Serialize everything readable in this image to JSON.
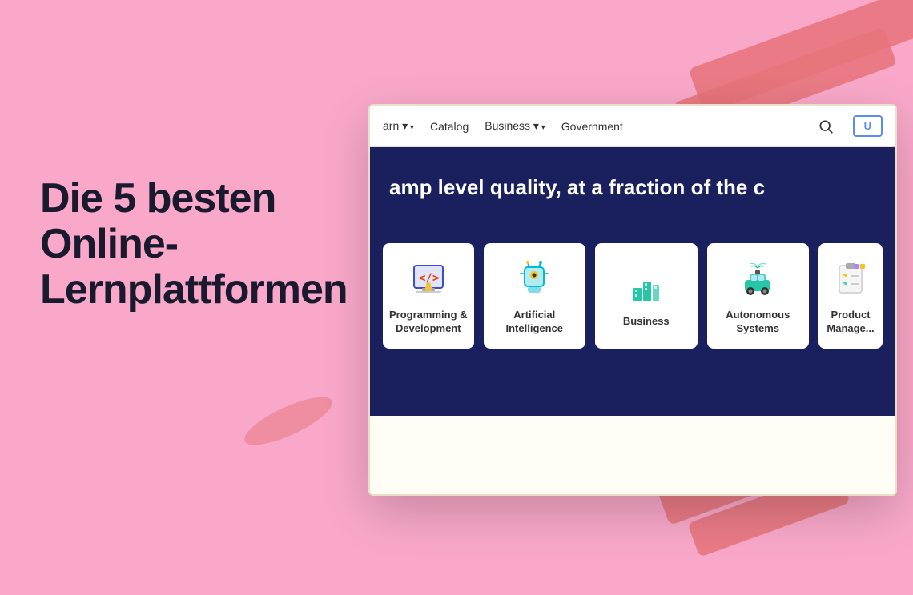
{
  "page": {
    "background_color": "#f9a8c9",
    "heading": "Die 5 besten Online-Lernplattformen"
  },
  "navbar": {
    "items": [
      {
        "label": "arn ▾",
        "has_dropdown": true,
        "id": "learn"
      },
      {
        "label": "Catalog",
        "has_dropdown": false,
        "id": "catalog"
      },
      {
        "label": "Business ▾",
        "has_dropdown": true,
        "id": "business"
      },
      {
        "label": "Government",
        "has_dropdown": false,
        "id": "government"
      }
    ],
    "search_label": "search",
    "button_label": "U"
  },
  "hero": {
    "text": "amp level quality, at a fraction of the c"
  },
  "categories": [
    {
      "id": "programming",
      "label": "Programming & Development",
      "icon_type": "programming",
      "partial": true
    },
    {
      "id": "ai",
      "label": "Artificial Intelligence",
      "icon_type": "ai",
      "partial": false
    },
    {
      "id": "business",
      "label": "Business",
      "icon_type": "business",
      "partial": false
    },
    {
      "id": "autonomous",
      "label": "Autonomous Systems",
      "icon_type": "autonomous",
      "partial": false
    },
    {
      "id": "product",
      "label": "Product Management",
      "icon_type": "product",
      "partial": true
    }
  ]
}
